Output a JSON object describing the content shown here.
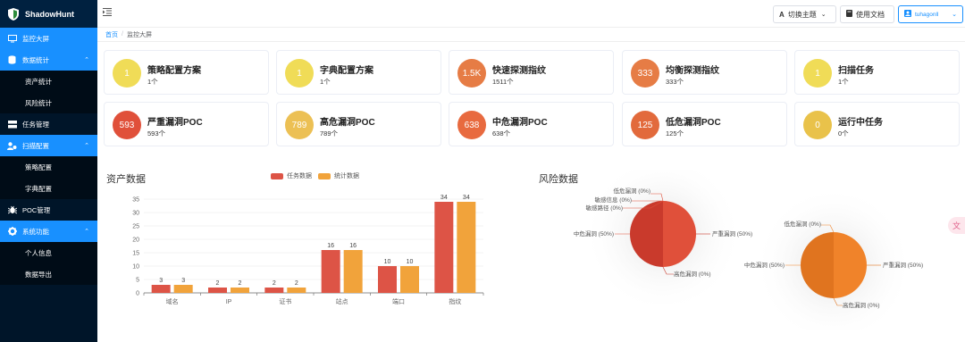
{
  "app": {
    "title": "ShadowHunt"
  },
  "sidebar": {
    "items": [
      {
        "label": "监控大屏",
        "icon": "monitor-icon",
        "active": true
      },
      {
        "label": "数据统计",
        "icon": "database-icon",
        "active": true,
        "children": [
          "资产统计",
          "风险统计"
        ]
      },
      {
        "label": "任务管理",
        "icon": "server-icon"
      },
      {
        "label": "扫描配置",
        "icon": "user-gear-icon",
        "active": true,
        "children": [
          "策略配置",
          "字典配置"
        ]
      },
      {
        "label": "POC管理",
        "icon": "bug-icon"
      },
      {
        "label": "系统功能",
        "icon": "gear-icon",
        "active": true,
        "children": [
          "个人信息",
          "数据导出"
        ]
      }
    ]
  },
  "header": {
    "theme_label": "切换主题",
    "doc_label": "使用文档",
    "user_label": "tuhagonll"
  },
  "breadcrumb": {
    "home": "首页",
    "current": "监控大屏"
  },
  "cards": [
    {
      "value": "1",
      "title": "策略配置方案",
      "sub": "1个",
      "color": "#f0dc57"
    },
    {
      "value": "1",
      "title": "字典配置方案",
      "sub": "1个",
      "color": "#f0dc57"
    },
    {
      "value": "1.5K",
      "title": "快速探测指纹",
      "sub": "1511个",
      "color": "#e67c45"
    },
    {
      "value": "333",
      "title": "均衡探测指纹",
      "sub": "333个",
      "color": "#e67c45"
    },
    {
      "value": "1",
      "title": "扫描任务",
      "sub": "1个",
      "color": "#f0dc57"
    },
    {
      "value": "593",
      "title": "严重漏洞POC",
      "sub": "593个",
      "color": "#e0503a"
    },
    {
      "value": "789",
      "title": "高危漏洞POC",
      "sub": "789个",
      "color": "#ecc054"
    },
    {
      "value": "638",
      "title": "中危漏洞POC",
      "sub": "638个",
      "color": "#e86a3f"
    },
    {
      "value": "125",
      "title": "低危漏洞POC",
      "sub": "125个",
      "color": "#e26a3c"
    },
    {
      "value": "0",
      "title": "运行中任务",
      "sub": "0个",
      "color": "#e9c24a"
    }
  ],
  "asset_section": {
    "title": "资产数据"
  },
  "risk_section": {
    "title": "风险数据"
  },
  "chart_data": [
    {
      "type": "bar",
      "title": "资产数据",
      "categories": [
        "域名",
        "IP",
        "证书",
        "站点",
        "端口",
        "指纹"
      ],
      "series": [
        {
          "name": "任务数据",
          "values": [
            3,
            2,
            2,
            16,
            10,
            34
          ],
          "color": "#dd5446"
        },
        {
          "name": "统计数据",
          "values": [
            3,
            2,
            2,
            16,
            10,
            34
          ],
          "color": "#f1a33b"
        }
      ],
      "ylim": [
        0,
        35
      ],
      "yticks": [
        0,
        5,
        10,
        15,
        20,
        25,
        30,
        35
      ],
      "grid": true,
      "legend": "top"
    },
    {
      "type": "pie",
      "title": "风险数据",
      "labels": [
        "低危漏洞 (0%)",
        "敏感信息 (0%)",
        "敏感路径 (0%)",
        "中危漏洞 (50%)",
        "严重漏洞 (50%)",
        "高危漏洞 (0%)"
      ],
      "values": [
        0,
        0,
        0,
        50,
        50,
        0
      ],
      "colors": [
        "#e0503a",
        "#c93a2c"
      ]
    },
    {
      "type": "pie",
      "labels": [
        "低危漏洞 (0%)",
        "中危漏洞 (50%)",
        "严重漏洞 (50%)",
        "高危漏洞 (0%)"
      ],
      "values": [
        0,
        50,
        50,
        0
      ],
      "colors": [
        "#f0832a",
        "#e0741f"
      ]
    }
  ]
}
